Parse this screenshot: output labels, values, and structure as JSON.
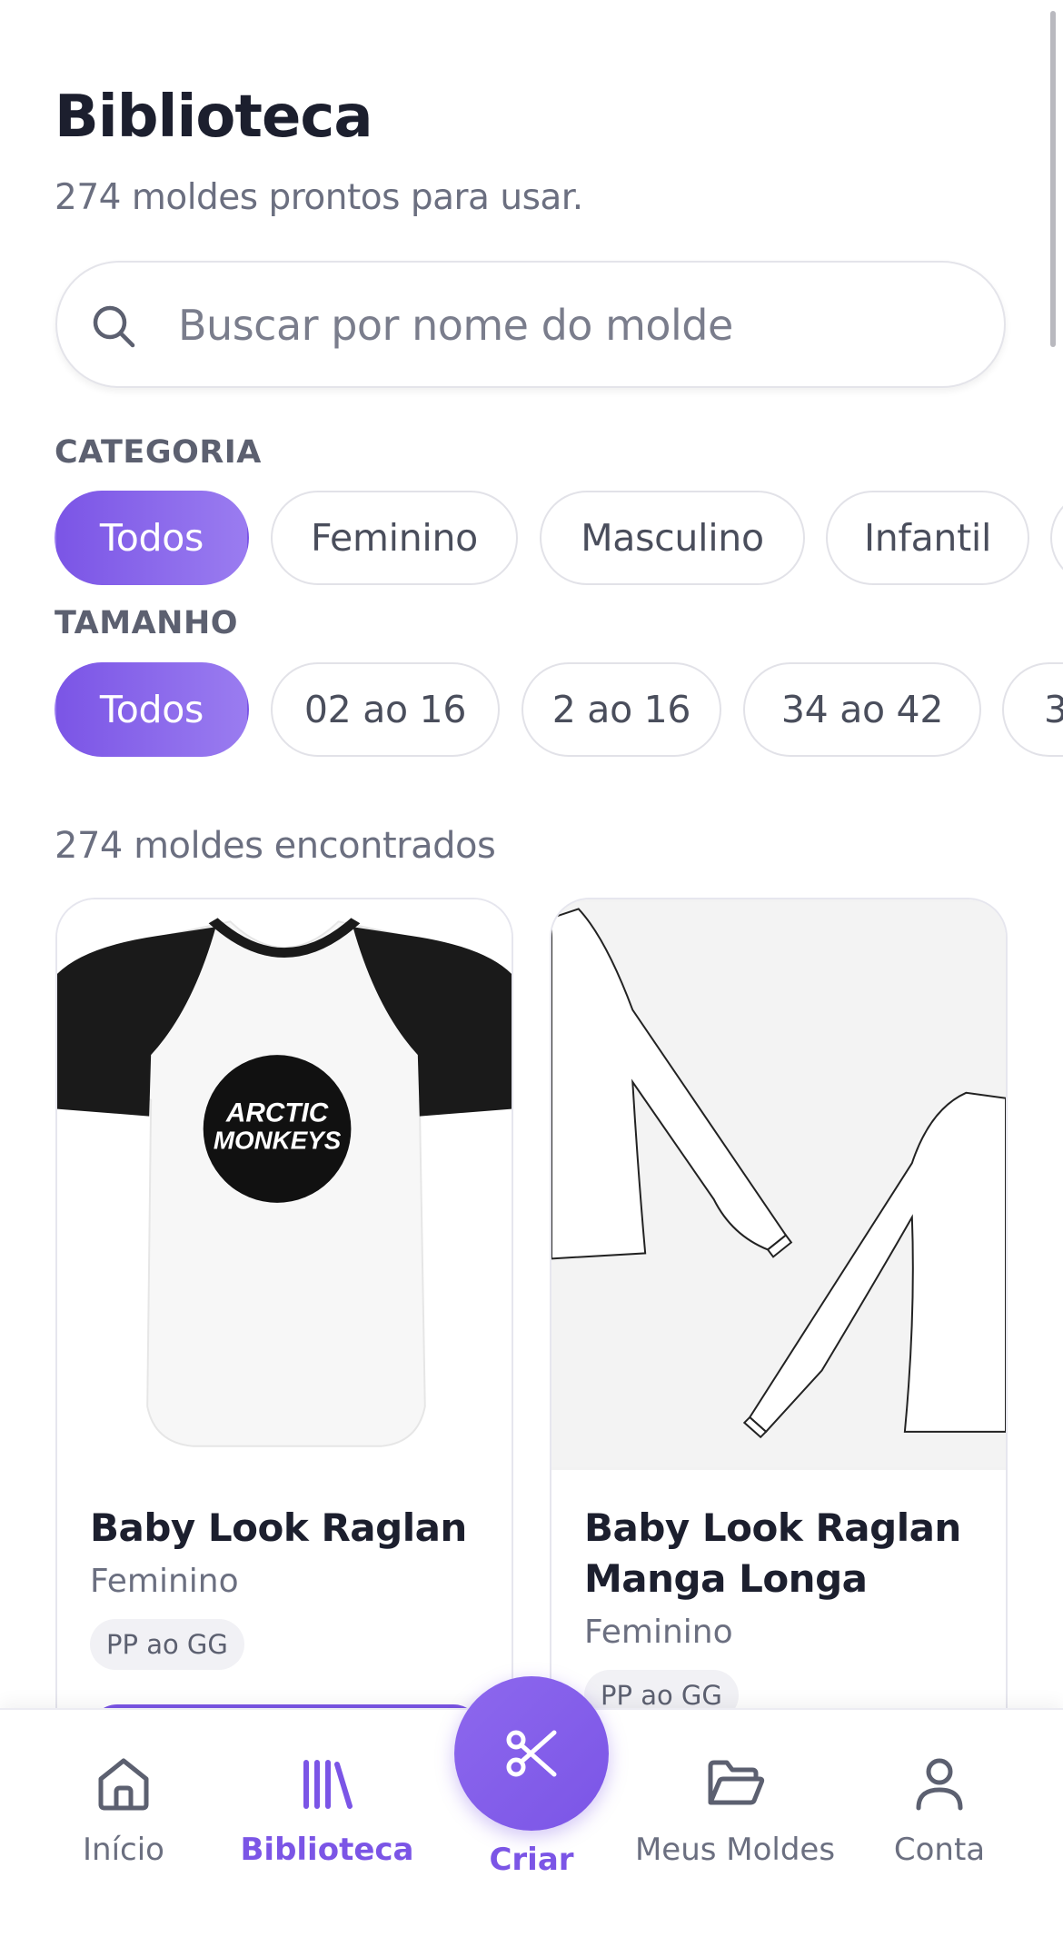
{
  "header": {
    "title": "Biblioteca",
    "subtitle": "274 moldes prontos para usar."
  },
  "search": {
    "placeholder": "Buscar por nome do molde",
    "value": "",
    "icon": "search-icon"
  },
  "filters": {
    "category": {
      "label": "CATEGORIA",
      "chips": [
        "Todos",
        "Feminino",
        "Masculino",
        "Infantil"
      ],
      "selected": "Todos"
    },
    "size": {
      "label": "TAMANHO",
      "chips": [
        "Todos",
        "02 ao 16",
        "2 ao 16",
        "34 ao 42",
        "3"
      ],
      "selected": "Todos"
    }
  },
  "results": {
    "count_text": "274 moldes encontrados",
    "items": [
      {
        "name": "Baby Look Raglan",
        "category": "Feminino",
        "size_range": "PP ao GG",
        "image_text_line1": "ARCTIC",
        "image_text_line2": "MONKEYS"
      },
      {
        "name": "Baby Look Raglan Manga Longa",
        "category": "Feminino",
        "size_range": "PP ao GG"
      }
    ]
  },
  "bottom_nav": {
    "items": [
      {
        "label": "Início",
        "icon": "home-icon",
        "active": false
      },
      {
        "label": "Biblioteca",
        "icon": "library-icon",
        "active": true
      },
      {
        "label": "Criar",
        "icon": "scissors-icon",
        "active": false
      },
      {
        "label": "Meus Moldes",
        "icon": "folder-icon",
        "active": false
      },
      {
        "label": "Conta",
        "icon": "user-icon",
        "active": false
      }
    ]
  },
  "colors": {
    "accent": "#7b55e6",
    "text_primary": "#1c1f2e",
    "text_secondary": "#6b6f80"
  }
}
